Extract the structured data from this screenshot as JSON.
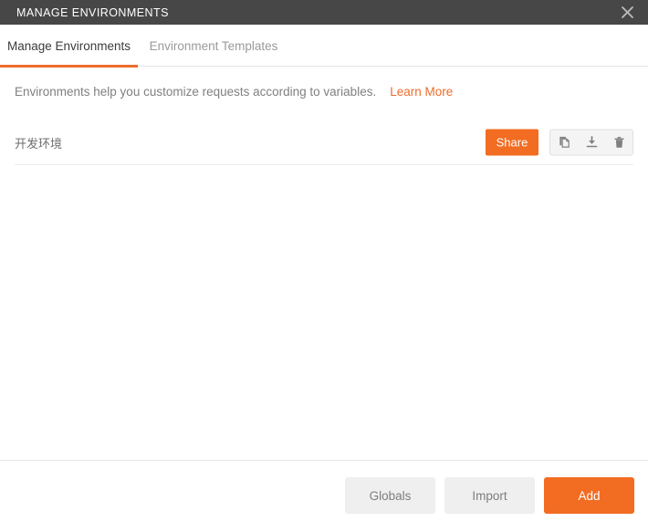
{
  "window": {
    "title": "MANAGE ENVIRONMENTS",
    "close_icon": "close-icon"
  },
  "tabs": [
    {
      "label": "Manage Environments",
      "active": true
    },
    {
      "label": "Environment Templates",
      "active": false
    }
  ],
  "description": {
    "text": "Environments help you customize requests according to variables.",
    "link_label": "Learn More"
  },
  "environments": [
    {
      "name": "开发环境",
      "share_label": "Share",
      "actions": [
        "duplicate-icon",
        "download-icon",
        "trash-icon"
      ]
    }
  ],
  "footer": {
    "globals_label": "Globals",
    "import_label": "Import",
    "add_label": "Add"
  },
  "colors": {
    "accent": "#f26c22",
    "titlebar": "#474747",
    "tab_active_text": "#3b3b3b",
    "tab_inactive_text": "#9a9a9a",
    "muted_text": "#808080",
    "button_secondary_bg": "#efefef"
  }
}
